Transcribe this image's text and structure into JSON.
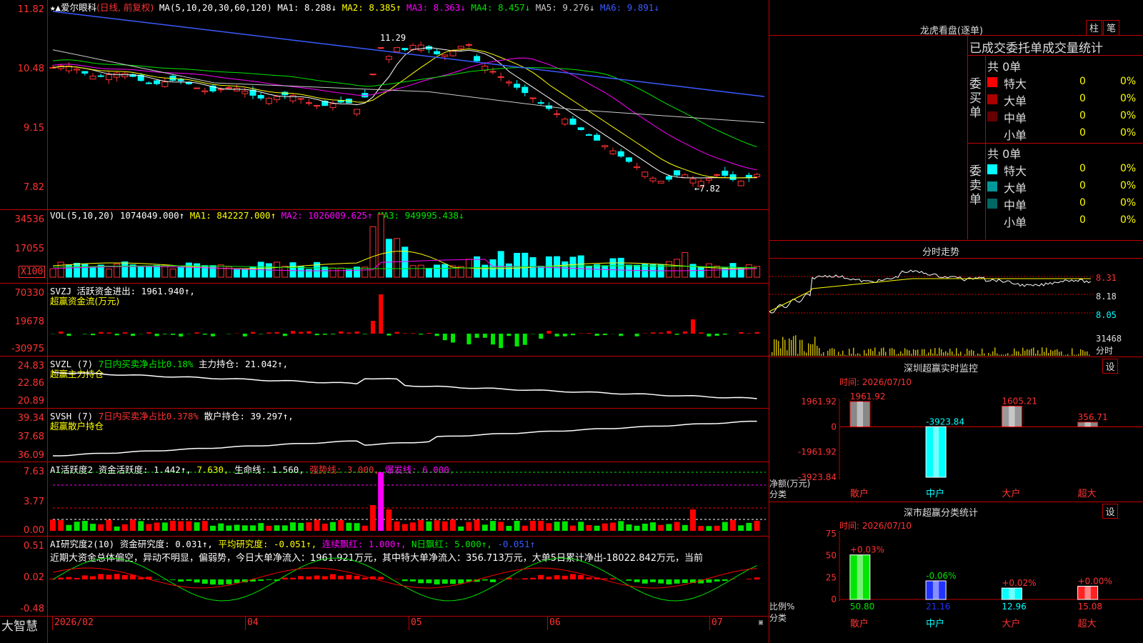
{
  "main": {
    "title_name": "爱尔眼科",
    "title_mode": "(日线, 前复权)",
    "ma_label": "MA(5,10,20,30,60,120)",
    "ma": [
      {
        "label": "MA1: 8.288↓",
        "color": "#ffffff"
      },
      {
        "label": "MA2: 8.385↑",
        "color": "#ffff00"
      },
      {
        "label": "MA3: 8.363↓",
        "color": "#ff00ff"
      },
      {
        "label": "MA4: 8.457↓",
        "color": "#00e600"
      },
      {
        "label": "MA5: 9.276↓",
        "color": "#cccccc"
      },
      {
        "label": "MA6: 9.891↓",
        "color": "#3b5bff"
      }
    ],
    "yticks": [
      "11.82",
      "10.48",
      "9.15",
      "7.82"
    ],
    "high_label": "11.29",
    "low_label": "←7.82"
  },
  "vol": {
    "title": "VOL(5,10,20)",
    "value": "1074049.000↑",
    "ma1": "MA1: 842227.000↑",
    "ma2": "MA2: 1026009.625↑",
    "ma3": "MA3: 949995.438↓",
    "yticks": [
      "34536",
      "17055"
    ],
    "unit": "X100"
  },
  "svzj": {
    "title": "SVZJ 活跃资金进出: 1961.940↑,",
    "subtitle": "超赢资金流(万元)",
    "yticks": [
      "70330",
      "19678",
      "-30975"
    ]
  },
  "svzl": {
    "title_a": "SVZL (7)",
    "title_b": "7日内买卖净占比0.18%",
    "title_c": "主力持仓: 21.042↑,",
    "subtitle": "超赢主力持仓",
    "yticks": [
      "24.83",
      "22.86",
      "20.89"
    ]
  },
  "svsh": {
    "title_a": "SVSH (7)",
    "title_b": "7日内买卖净占比0.378%",
    "title_c": "散户持仓: 39.297↑,",
    "subtitle": "超赢散户持仓",
    "yticks": [
      "39.34",
      "37.68",
      "36.09"
    ]
  },
  "ai_act": {
    "title_a": "AI活跃度2 资金活跃度: 1.442↑,",
    "title_b": "7.630,",
    "title_c": "生命线: 1.560,",
    "title_d": "强势线: 3.000,",
    "title_e": "爆发线: 6.000,",
    "yticks": [
      "7.63",
      "3.77",
      "0.00"
    ]
  },
  "ai_res": {
    "title_a": "AI研究度2(10) 资金研究度: 0.031↑,",
    "title_b": "平均研究度: -0.051↑,",
    "title_c": "连续飘红: 1.000↑,",
    "title_d": "N日飘红: 5.000↑,",
    "title_e": "-0.051↑",
    "summary": "近期大资金总体偏空，异动不明显，偏弱势，今日大单净流入：1961.921万元，其中特大单净流入：356.713万元，大单5日累计净出-18022.842万元，当前",
    "yticks": [
      "0.51",
      "0.02",
      "-0.48"
    ]
  },
  "xaxis": {
    "brand": "大智慧",
    "labels": [
      "2026/02",
      "04",
      "05",
      "06",
      "07"
    ]
  },
  "right": {
    "lhb_title": "龙虎看盘(逐单)",
    "btn_zhu": "柱",
    "btn_bi": "笔",
    "order_title": "已成交委托单成交量统计",
    "buy_side_label": "委买单",
    "sell_side_label": "委卖单",
    "buy_total": "共 0单",
    "sell_total": "共 0单",
    "buy_rows": [
      {
        "name": "特大",
        "color": "#ff0000",
        "count": "0",
        "pct": "0%"
      },
      {
        "name": "大单",
        "color": "#aa0000",
        "count": "0",
        "pct": "0%"
      },
      {
        "name": "中单",
        "color": "#660000",
        "count": "0",
        "pct": "0%"
      },
      {
        "name": "小单",
        "color": "#000000",
        "count": "0",
        "pct": "0%"
      }
    ],
    "sell_rows": [
      {
        "name": "特大",
        "color": "#00ffff",
        "count": "0",
        "pct": "0%"
      },
      {
        "name": "大单",
        "color": "#009999",
        "count": "0",
        "pct": "0%"
      },
      {
        "name": "中单",
        "color": "#006666",
        "count": "0",
        "pct": "0%"
      },
      {
        "name": "小单",
        "color": "#000000",
        "count": "0",
        "pct": "0%"
      }
    ],
    "fs_title": "分时走势",
    "fs_yticks": [
      "8.31",
      "8.18",
      "8.05"
    ],
    "fs_vol_label": "31468",
    "fs_foot": "分时",
    "monitor_title": "深圳超赢实时监控",
    "monitor_time": "时间: 2026/07/10",
    "monitor_yticks": [
      "1961.92",
      "0",
      "-1961.92",
      "-3923.84"
    ],
    "monitor_ylabel": "净额(万元)",
    "monitor_cat_label": "分类",
    "set_btn": "设",
    "classify_title": "深市超赢分类统计",
    "classify_time": "时间: 2026/07/10",
    "classify_yticks": [
      "75",
      "50",
      "25",
      "0"
    ],
    "classify_ylabel": "比例%",
    "classify_cat_label": "分类"
  },
  "chart_data": [
    {
      "type": "bar",
      "title": "深圳超赢实时监控",
      "categories": [
        "散户",
        "中户",
        "大户",
        "超大"
      ],
      "values": [
        1961.92,
        -3923.84,
        1605.21,
        356.71
      ],
      "value_labels": [
        "1961.92",
        "-3923.84",
        "1605.21",
        "356.71"
      ],
      "ylabel": "净额(万元)",
      "ylim": [
        -3923.84,
        1961.92
      ]
    },
    {
      "type": "bar",
      "title": "深市超赢分类统计",
      "categories": [
        "散户",
        "中户",
        "大户",
        "超大"
      ],
      "values": [
        50.8,
        21.16,
        12.96,
        15.08
      ],
      "changes": [
        "+0.03%",
        "-0.06%",
        "+0.02%",
        "+0.00%"
      ],
      "value_labels": [
        "50.80",
        "21.16",
        "12.96",
        "15.08"
      ],
      "ylabel": "比例%",
      "ylim": [
        0,
        75
      ]
    }
  ]
}
